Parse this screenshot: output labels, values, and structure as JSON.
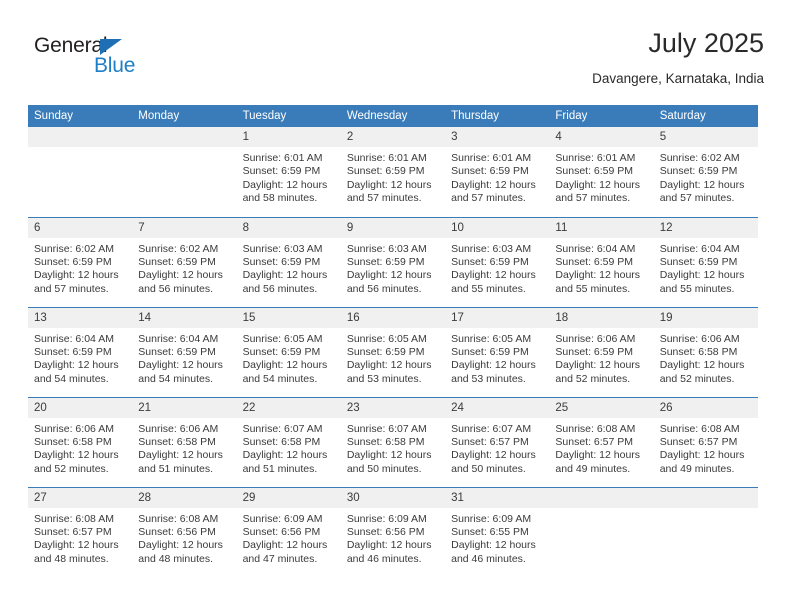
{
  "brand": {
    "name_part1": "General",
    "name_part2": "Blue",
    "triangle_icon": "triangle-flag-icon",
    "colors": {
      "dark": "#231f20",
      "blue": "#1f7fc6",
      "triangle": "#1f6fb5"
    }
  },
  "header": {
    "title": "July 2025",
    "subtitle": "Davangere, Karnataka, India"
  },
  "theme": {
    "header_blue": "#3a7cb9",
    "daynum_band": "#f0f0f0",
    "text": "#3b3b3b"
  },
  "weekdays": [
    "Sunday",
    "Monday",
    "Tuesday",
    "Wednesday",
    "Thursday",
    "Friday",
    "Saturday"
  ],
  "weeks": [
    [
      {
        "day": "",
        "lines": []
      },
      {
        "day": "",
        "lines": []
      },
      {
        "day": "1",
        "lines": [
          "Sunrise: 6:01 AM",
          "Sunset: 6:59 PM",
          "Daylight: 12 hours",
          "and 58 minutes."
        ]
      },
      {
        "day": "2",
        "lines": [
          "Sunrise: 6:01 AM",
          "Sunset: 6:59 PM",
          "Daylight: 12 hours",
          "and 57 minutes."
        ]
      },
      {
        "day": "3",
        "lines": [
          "Sunrise: 6:01 AM",
          "Sunset: 6:59 PM",
          "Daylight: 12 hours",
          "and 57 minutes."
        ]
      },
      {
        "day": "4",
        "lines": [
          "Sunrise: 6:01 AM",
          "Sunset: 6:59 PM",
          "Daylight: 12 hours",
          "and 57 minutes."
        ]
      },
      {
        "day": "5",
        "lines": [
          "Sunrise: 6:02 AM",
          "Sunset: 6:59 PM",
          "Daylight: 12 hours",
          "and 57 minutes."
        ]
      }
    ],
    [
      {
        "day": "6",
        "lines": [
          "Sunrise: 6:02 AM",
          "Sunset: 6:59 PM",
          "Daylight: 12 hours",
          "and 57 minutes."
        ]
      },
      {
        "day": "7",
        "lines": [
          "Sunrise: 6:02 AM",
          "Sunset: 6:59 PM",
          "Daylight: 12 hours",
          "and 56 minutes."
        ]
      },
      {
        "day": "8",
        "lines": [
          "Sunrise: 6:03 AM",
          "Sunset: 6:59 PM",
          "Daylight: 12 hours",
          "and 56 minutes."
        ]
      },
      {
        "day": "9",
        "lines": [
          "Sunrise: 6:03 AM",
          "Sunset: 6:59 PM",
          "Daylight: 12 hours",
          "and 56 minutes."
        ]
      },
      {
        "day": "10",
        "lines": [
          "Sunrise: 6:03 AM",
          "Sunset: 6:59 PM",
          "Daylight: 12 hours",
          "and 55 minutes."
        ]
      },
      {
        "day": "11",
        "lines": [
          "Sunrise: 6:04 AM",
          "Sunset: 6:59 PM",
          "Daylight: 12 hours",
          "and 55 minutes."
        ]
      },
      {
        "day": "12",
        "lines": [
          "Sunrise: 6:04 AM",
          "Sunset: 6:59 PM",
          "Daylight: 12 hours",
          "and 55 minutes."
        ]
      }
    ],
    [
      {
        "day": "13",
        "lines": [
          "Sunrise: 6:04 AM",
          "Sunset: 6:59 PM",
          "Daylight: 12 hours",
          "and 54 minutes."
        ]
      },
      {
        "day": "14",
        "lines": [
          "Sunrise: 6:04 AM",
          "Sunset: 6:59 PM",
          "Daylight: 12 hours",
          "and 54 minutes."
        ]
      },
      {
        "day": "15",
        "lines": [
          "Sunrise: 6:05 AM",
          "Sunset: 6:59 PM",
          "Daylight: 12 hours",
          "and 54 minutes."
        ]
      },
      {
        "day": "16",
        "lines": [
          "Sunrise: 6:05 AM",
          "Sunset: 6:59 PM",
          "Daylight: 12 hours",
          "and 53 minutes."
        ]
      },
      {
        "day": "17",
        "lines": [
          "Sunrise: 6:05 AM",
          "Sunset: 6:59 PM",
          "Daylight: 12 hours",
          "and 53 minutes."
        ]
      },
      {
        "day": "18",
        "lines": [
          "Sunrise: 6:06 AM",
          "Sunset: 6:59 PM",
          "Daylight: 12 hours",
          "and 52 minutes."
        ]
      },
      {
        "day": "19",
        "lines": [
          "Sunrise: 6:06 AM",
          "Sunset: 6:58 PM",
          "Daylight: 12 hours",
          "and 52 minutes."
        ]
      }
    ],
    [
      {
        "day": "20",
        "lines": [
          "Sunrise: 6:06 AM",
          "Sunset: 6:58 PM",
          "Daylight: 12 hours",
          "and 52 minutes."
        ]
      },
      {
        "day": "21",
        "lines": [
          "Sunrise: 6:06 AM",
          "Sunset: 6:58 PM",
          "Daylight: 12 hours",
          "and 51 minutes."
        ]
      },
      {
        "day": "22",
        "lines": [
          "Sunrise: 6:07 AM",
          "Sunset: 6:58 PM",
          "Daylight: 12 hours",
          "and 51 minutes."
        ]
      },
      {
        "day": "23",
        "lines": [
          "Sunrise: 6:07 AM",
          "Sunset: 6:58 PM",
          "Daylight: 12 hours",
          "and 50 minutes."
        ]
      },
      {
        "day": "24",
        "lines": [
          "Sunrise: 6:07 AM",
          "Sunset: 6:57 PM",
          "Daylight: 12 hours",
          "and 50 minutes."
        ]
      },
      {
        "day": "25",
        "lines": [
          "Sunrise: 6:08 AM",
          "Sunset: 6:57 PM",
          "Daylight: 12 hours",
          "and 49 minutes."
        ]
      },
      {
        "day": "26",
        "lines": [
          "Sunrise: 6:08 AM",
          "Sunset: 6:57 PM",
          "Daylight: 12 hours",
          "and 49 minutes."
        ]
      }
    ],
    [
      {
        "day": "27",
        "lines": [
          "Sunrise: 6:08 AM",
          "Sunset: 6:57 PM",
          "Daylight: 12 hours",
          "and 48 minutes."
        ]
      },
      {
        "day": "28",
        "lines": [
          "Sunrise: 6:08 AM",
          "Sunset: 6:56 PM",
          "Daylight: 12 hours",
          "and 48 minutes."
        ]
      },
      {
        "day": "29",
        "lines": [
          "Sunrise: 6:09 AM",
          "Sunset: 6:56 PM",
          "Daylight: 12 hours",
          "and 47 minutes."
        ]
      },
      {
        "day": "30",
        "lines": [
          "Sunrise: 6:09 AM",
          "Sunset: 6:56 PM",
          "Daylight: 12 hours",
          "and 46 minutes."
        ]
      },
      {
        "day": "31",
        "lines": [
          "Sunrise: 6:09 AM",
          "Sunset: 6:55 PM",
          "Daylight: 12 hours",
          "and 46 minutes."
        ]
      },
      {
        "day": "",
        "lines": []
      },
      {
        "day": "",
        "lines": []
      }
    ]
  ]
}
